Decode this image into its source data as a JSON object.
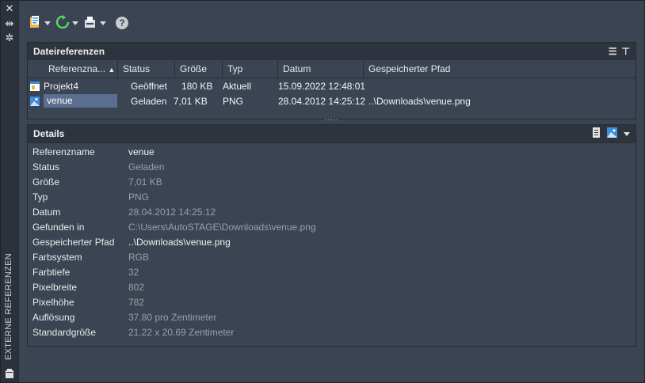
{
  "sidebar": {
    "vertical_title": "EXTERNE REFERENZEN",
    "icons": [
      "close-icon",
      "pin-icon",
      "settings-icon",
      "clipboard-icon"
    ]
  },
  "toolbar": {
    "buttons": [
      "attach-icon",
      "refresh-icon",
      "bind-icon"
    ],
    "help_label": "?"
  },
  "file_refs": {
    "title": "Dateireferenzen",
    "columns": [
      "Referenzna...",
      "Status",
      "Größe",
      "Typ",
      "Datum",
      "Gespeicherter Pfad"
    ],
    "rows": [
      {
        "name": "Projekt4",
        "status": "Geöffnet",
        "size": "180 KB",
        "type": "Aktuell",
        "date": "15.09.2022 12:48:01",
        "path": ""
      },
      {
        "name": "venue",
        "status": "Geladen",
        "size": "7,01 KB",
        "type": "PNG",
        "date": "28.04.2012 14:25:12",
        "path": "..\\Downloads\\venue.png"
      }
    ],
    "grip": "....."
  },
  "details": {
    "title": "Details",
    "rows": [
      {
        "label": "Referenzname",
        "value": "venue"
      },
      {
        "label": "Status",
        "value": "Geladen"
      },
      {
        "label": "Größe",
        "value": "7,01 KB"
      },
      {
        "label": "Typ",
        "value": "PNG"
      },
      {
        "label": "Datum",
        "value": "28.04.2012 14:25:12"
      },
      {
        "label": "Gefunden in",
        "value": "C:\\Users\\AutoSTAGE\\Downloads\\venue.png"
      },
      {
        "label": "Gespeicherter Pfad",
        "value": "..\\Downloads\\venue.png"
      },
      {
        "label": "Farbsystem",
        "value": "RGB"
      },
      {
        "label": "Farbtiefe",
        "value": "32"
      },
      {
        "label": "Pixelbreite",
        "value": "802"
      },
      {
        "label": "Pixelhöhe",
        "value": "782"
      },
      {
        "label": "Auflösung",
        "value": "37.80 pro Zentimeter"
      },
      {
        "label": "Standardgröße",
        "value": "21.22 x 20.69 Zentimeter"
      }
    ]
  },
  "colors": {
    "background": "#3b4453",
    "header": "#2e343e",
    "selection": "#5b6e8f",
    "accent_green": "#5fd36a",
    "accent_blue": "#3e8ee0",
    "accent_yellow": "#e9b949"
  }
}
